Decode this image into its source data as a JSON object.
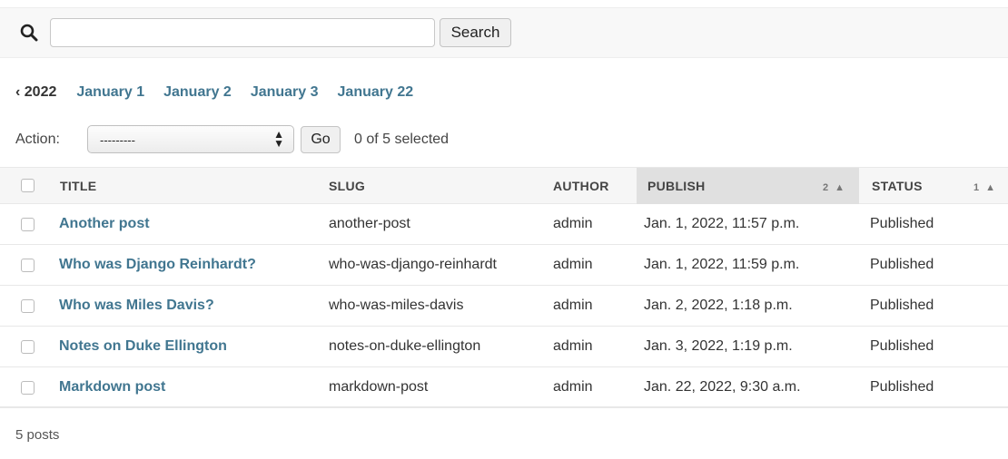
{
  "search": {
    "value": "",
    "placeholder": "",
    "button_label": "Search",
    "icon": "search-icon"
  },
  "date_hierarchy": {
    "back_label": "‹ 2022",
    "links": [
      "January 1",
      "January 2",
      "January 3",
      "January 22"
    ]
  },
  "actions": {
    "label": "Action:",
    "selected_option": "---------",
    "go_label": "Go",
    "counter": "0 of 5 selected"
  },
  "table": {
    "columns": {
      "title": "TITLE",
      "slug": "SLUG",
      "author": "AUTHOR",
      "publish": "PUBLISH",
      "status": "STATUS"
    },
    "sort": {
      "publish_priority": "2",
      "status_priority": "1"
    },
    "rows": [
      {
        "title": "Another post",
        "slug": "another-post",
        "author": "admin",
        "publish": "Jan. 1, 2022, 11:57 p.m.",
        "status": "Published"
      },
      {
        "title": "Who was Django Reinhardt?",
        "slug": "who-was-django-reinhardt",
        "author": "admin",
        "publish": "Jan. 1, 2022, 11:59 p.m.",
        "status": "Published"
      },
      {
        "title": "Who was Miles Davis?",
        "slug": "who-was-miles-davis",
        "author": "admin",
        "publish": "Jan. 2, 2022, 1:18 p.m.",
        "status": "Published"
      },
      {
        "title": "Notes on Duke Ellington",
        "slug": "notes-on-duke-ellington",
        "author": "admin",
        "publish": "Jan. 3, 2022, 1:19 p.m.",
        "status": "Published"
      },
      {
        "title": "Markdown post",
        "slug": "markdown-post",
        "author": "admin",
        "publish": "Jan. 22, 2022, 9:30 a.m.",
        "status": "Published"
      }
    ]
  },
  "paginator": {
    "text": "5 posts"
  },
  "colors": {
    "link": "#417690",
    "header_bg": "#f6f6f6",
    "sorted_header_bg": "#e0e0e0"
  }
}
